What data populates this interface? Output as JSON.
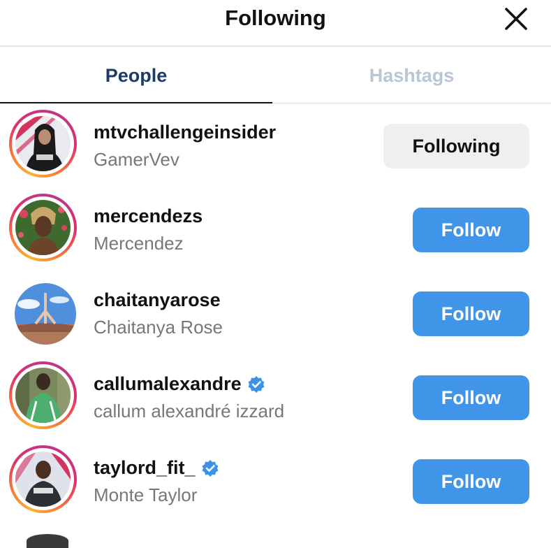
{
  "header": {
    "title": "Following"
  },
  "tabs": [
    {
      "label": "People",
      "active": true
    },
    {
      "label": "Hashtags",
      "active": false
    }
  ],
  "colors": {
    "follow_button": "#4095e9",
    "following_button": "#efefef",
    "verified_badge": "#3d92e8",
    "active_tab": "#1c3b6b",
    "inactive_tab": "#b9c6d3"
  },
  "users": [
    {
      "username": "mtvchallengeinsider",
      "full_name": "GamerVev",
      "verified": false,
      "button": "Following",
      "story_ring": true
    },
    {
      "username": "mercendezs",
      "full_name": "Mercendez",
      "verified": false,
      "button": "Follow",
      "story_ring": true
    },
    {
      "username": "chaitanyarose",
      "full_name": "Chaitanya Rose",
      "verified": false,
      "button": "Follow",
      "story_ring": false
    },
    {
      "username": "callumalexandre",
      "full_name": "callum alexandré izzard",
      "verified": true,
      "button": "Follow",
      "story_ring": true
    },
    {
      "username": "taylord_fit_",
      "full_name": "Monte Taylor",
      "verified": true,
      "button": "Follow",
      "story_ring": true
    }
  ]
}
